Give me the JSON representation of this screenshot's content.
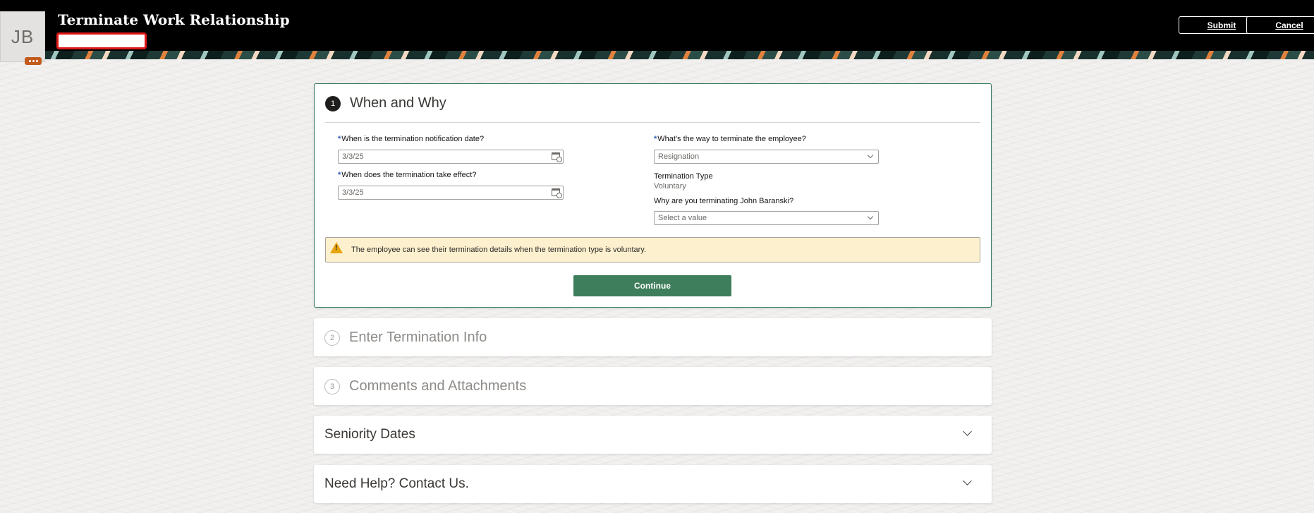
{
  "header": {
    "avatar_initials": "JB",
    "title": "Terminate Work Relationship",
    "submit_label": "Submit",
    "cancel_label": "Cancel"
  },
  "step1": {
    "number": "1",
    "title": "When and Why",
    "notification_date_label": "When is the termination notification date?",
    "notification_date_value": "3/3/25",
    "effective_date_label": "When does the termination take effect?",
    "effective_date_value": "3/3/25",
    "action_label": "What's the way to terminate the employee?",
    "action_value": "Resignation",
    "termination_type_label": "Termination Type",
    "termination_type_value": "Voluntary",
    "reason_label": "Why are you terminating John Baranski?",
    "reason_placeholder": "Select a value",
    "required_marker": "*",
    "warning_text": "The employee can see their termination details when the termination type is voluntary.",
    "continue_label": "Continue"
  },
  "step2": {
    "number": "2",
    "title": "Enter Termination Info"
  },
  "step3": {
    "number": "3",
    "title": "Comments and Attachments"
  },
  "sections": {
    "seniority": "Seniority Dates",
    "help": "Need Help? Contact Us."
  },
  "colors": {
    "accent_green": "#3e7e5c",
    "warning_bg": "#fdf0cf",
    "required_blue": "#2d59b5"
  }
}
